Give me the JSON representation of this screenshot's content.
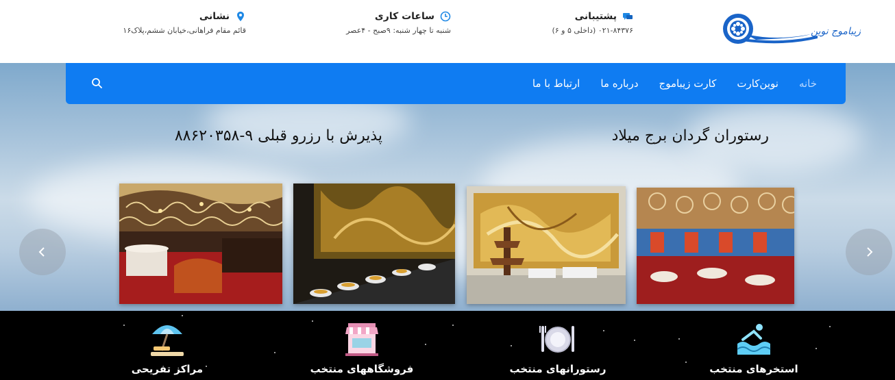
{
  "header": {
    "logo_text": "زیباموج نوین",
    "support": {
      "title": "پشتیبانی",
      "value": "۰۲۱-۸۴۳۷۶ (داخلی ۵ و ۶)"
    },
    "hours": {
      "title": "ساعات کاری",
      "value": "شنبه تا چهار شنبه: ۹صبح - ۴عصر"
    },
    "address": {
      "title": "نشانی",
      "value": "قائم مقام فراهانی،خیابان ششم،پلاک۱۶"
    }
  },
  "nav": {
    "items": [
      {
        "label": "خانه"
      },
      {
        "label": "نوین‌کارت"
      },
      {
        "label": "کارت زیباموج"
      },
      {
        "label": "درباره ما"
      },
      {
        "label": "ارتباط با ما"
      }
    ]
  },
  "slider": {
    "headline_right": "رستوران گردان برج میلاد",
    "headline_left": "پذیرش با رزرو قبلی ۹-۸۸۶۲۰۳۵۸"
  },
  "categories": [
    {
      "label": "استخرهای منتخب",
      "icon": "pool-icon"
    },
    {
      "label": "رستورانهای منتخب",
      "icon": "dinner-plate-icon"
    },
    {
      "label": "فروشگاههای منتخب",
      "icon": "shop-icon"
    },
    {
      "label": "مراکز تفریحی",
      "icon": "beach-umbrella-icon"
    }
  ],
  "colors": {
    "nav_blue": "#0f7cf2",
    "logo_blue": "#1a64c8",
    "icon_blue": "#1e88e5"
  }
}
